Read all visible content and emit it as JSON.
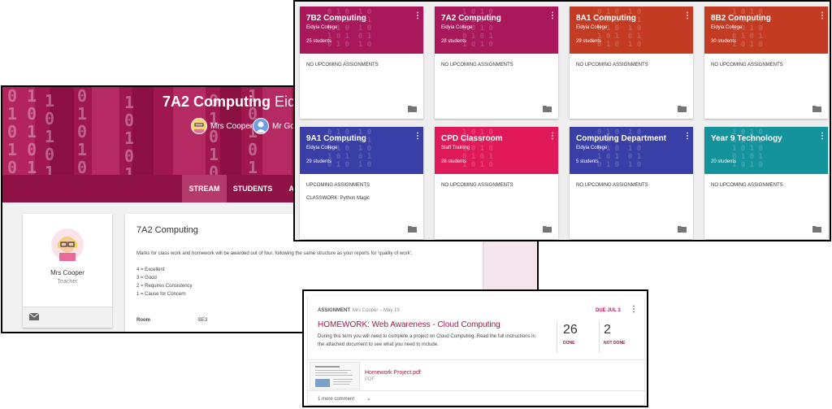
{
  "class_page": {
    "title": "7A2 Computing",
    "title_suffix": "Eidyia",
    "teacher_chip_1": "Mrs Cooper",
    "teacher_chip_2": "Mr Go",
    "tabs": [
      "STREAM",
      "STUDENTS",
      "AB"
    ],
    "teacher_card": {
      "name": "Mrs Cooper",
      "role": "Teacher"
    },
    "about": {
      "title": "7A2 Computing",
      "description": "Marks for class work and homework will be awarded out of four, following the same structure as your reports for 'quality of work'.",
      "scale": [
        "4 = Excellent",
        "3 = Good",
        "2 = Requires Consistency",
        "1 = Cause for Concern"
      ],
      "room_label": "Room",
      "room_value": "BE3"
    },
    "banner_color": "#a0164f"
  },
  "class_grid": {
    "cards": [
      {
        "title": "7B2 Computing",
        "subtitle": "Eidyia College",
        "count": "25 students",
        "line1": "NO UPCOMING ASSIGNMENTS",
        "line2": "",
        "color": "#a8185a"
      },
      {
        "title": "7A2 Computing",
        "subtitle": "Eidyia College",
        "count": "28 students",
        "line1": "NO UPCOMING ASSIGNMENTS",
        "line2": "",
        "color": "#a8185a"
      },
      {
        "title": "8A1 Computing",
        "subtitle": "Eidyia College",
        "count": "29 students",
        "line1": "NO UPCOMING ASSIGNMENTS",
        "line2": "",
        "color": "#c23b22"
      },
      {
        "title": "8B2 Computing",
        "subtitle": "Eidyia College",
        "count": "30 students",
        "line1": "NO UPCOMING ASSIGNMENTS",
        "line2": "",
        "color": "#c23b22"
      },
      {
        "title": "9A1 Computing",
        "subtitle": "Eidyia College",
        "count": "29 students",
        "line1": "UPCOMING ASSIGNMENTS",
        "line2": "CLASSWORK: Python Magic",
        "color": "#3a3fa8"
      },
      {
        "title": "CPD Classroom",
        "subtitle": "Staff Training",
        "count": "26 students",
        "line1": "NO UPCOMING ASSIGNMENTS",
        "line2": "",
        "color": "#e0195a"
      },
      {
        "title": "Computing Department",
        "subtitle": "Eidyia College",
        "count": "5 students",
        "line1": "NO UPCOMING ASSIGNMENTS",
        "line2": "",
        "color": "#3a3fa8"
      },
      {
        "title": "Year 9 Technology",
        "subtitle": "",
        "count": "20 students",
        "line1": "NO UPCOMING ASSIGNMENTS",
        "line2": "",
        "color": "#14939d"
      }
    ]
  },
  "assignment": {
    "type": "ASSIGNMENT",
    "author": "Mrs Cooper – May 19",
    "due": "DUE JUL 3",
    "title": "HOMEWORK: Web Awareness - Cloud Computing",
    "description": "During this term you will need to complete a project on Cloud Computing. Read the full instructions in the attached document to see what you need to include.",
    "done_count": "26",
    "done_label": "DONE",
    "not_done_count": "2",
    "not_done_label": "NOT DONE",
    "attachment_name": "Homework Project.pdf",
    "attachment_type": "PDF",
    "comments": "1 more comment"
  }
}
